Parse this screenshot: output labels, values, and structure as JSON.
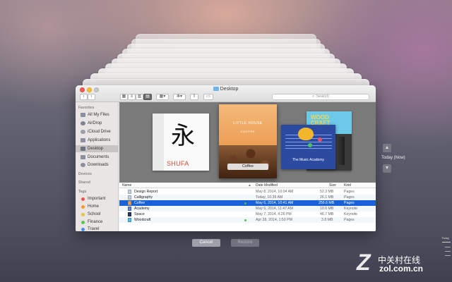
{
  "window": {
    "title": "Desktop",
    "search_placeholder": "Search",
    "toolbar_icons": [
      "back-icon",
      "forward-icon",
      "icon-view-icon",
      "list-view-icon",
      "column-view-icon",
      "cover-flow-icon",
      "arrange-icon",
      "action-gear-icon",
      "share-icon",
      "tag-icon"
    ]
  },
  "sidebar": {
    "favorites_header": "Favorites",
    "favorites": [
      {
        "label": "All My Files",
        "icon": "all-files-icon"
      },
      {
        "label": "AirDrop",
        "icon": "airdrop-icon"
      },
      {
        "label": "iCloud Drive",
        "icon": "cloud-icon"
      },
      {
        "label": "Applications",
        "icon": "applications-icon"
      },
      {
        "label": "Desktop",
        "icon": "desktop-icon",
        "selected": true
      },
      {
        "label": "Documents",
        "icon": "documents-icon"
      },
      {
        "label": "Downloads",
        "icon": "downloads-icon"
      }
    ],
    "devices_header": "Devices",
    "shared_header": "Shared",
    "tags_header": "Tags",
    "tags": [
      {
        "label": "Important",
        "color": "#f0534c"
      },
      {
        "label": "Home",
        "color": "#f39a2a"
      },
      {
        "label": "School",
        "color": "#e6c63a"
      },
      {
        "label": "Finance",
        "color": "#5cc653"
      },
      {
        "label": "Travel",
        "color": "#4b8ef0"
      }
    ]
  },
  "coverflow": {
    "selected_caption": "Coffee",
    "shufa": {
      "glyph": "永",
      "label": "SHUFA"
    },
    "coffee": {
      "line1": "LITTLE HOUSE",
      "line2": "COFFEE"
    },
    "music": {
      "label": "The Music Academy"
    },
    "woodcraft": {
      "label": "WOOD CRAFT"
    }
  },
  "list": {
    "columns": {
      "name": "Name",
      "date": "Date Modified",
      "size": "Size",
      "kind": "Kind"
    },
    "rows": [
      {
        "name": "Design Report",
        "date": "May 8, 2014, 10:04 AM",
        "size": "52.3 MB",
        "kind": "Pages",
        "tag": ""
      },
      {
        "name": "Calligraphy",
        "date": "Today, 10:39 AM",
        "size": "26.1 MB",
        "kind": "Pages",
        "tag": ""
      },
      {
        "name": "Coffee",
        "date": "May 6, 2014, 10:41 AM",
        "size": "256.6 MB",
        "kind": "Pages",
        "tag": "#45c645",
        "selected": true
      },
      {
        "name": "Academy",
        "date": "May 6, 2014, 11:47 AM",
        "size": "10.6 MB",
        "kind": "Keynote",
        "tag": ""
      },
      {
        "name": "Space",
        "date": "May 7, 2014, 4:26 PM",
        "size": "46.7 MB",
        "kind": "Keynote",
        "tag": ""
      },
      {
        "name": "Woodcraft",
        "date": "Apr 28, 2014, 1:50 PM",
        "size": "3.8 MB",
        "kind": "Pages",
        "tag": "#45c645"
      }
    ]
  },
  "buttons": {
    "cancel": "Cancel",
    "restore": "Restore"
  },
  "timemachine": {
    "current_label": "Today (Now)",
    "timeline_label": "Today"
  },
  "watermark": {
    "text": "中关村在线",
    "url": "zol.com.cn",
    "logo_letter": "Z"
  }
}
